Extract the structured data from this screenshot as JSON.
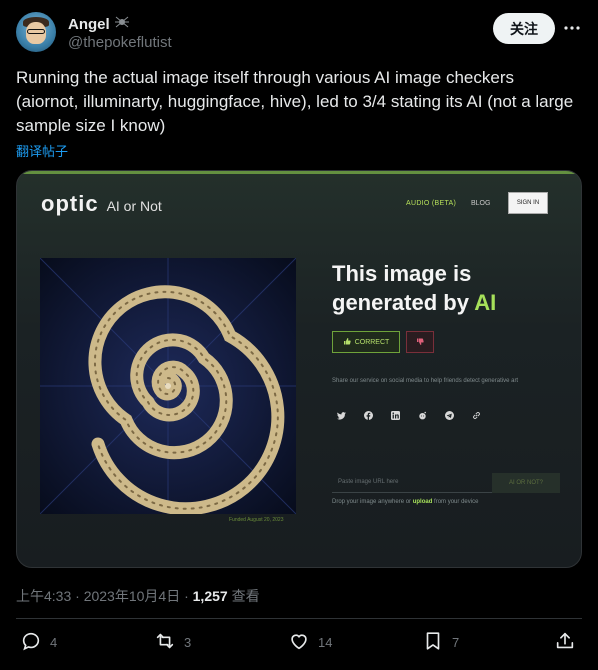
{
  "author": {
    "name": "Angel",
    "badge_icon": "spider-icon",
    "handle": "@thepokeflutist"
  },
  "follow_label": "关注",
  "tweet": {
    "text": "Running the actual image itself through various AI image checkers (aiornot, illuminarty, huggingface, hive), led to 3/4 stating its AI (not a large sample size I know)",
    "translate": "翻译帖子",
    "timestamp": "上午4:33 · 2023年10月4日 · ",
    "views": "1,257",
    "views_label": " 查看"
  },
  "embedded": {
    "logo_word": "optic",
    "logo_sub": "AI or Not",
    "nav_audio": "AUDIO (BETA)",
    "nav_blog": "BLOG",
    "nav_signin": "SIGN IN",
    "headline_line1": "This image is",
    "headline_line2": "generated by ",
    "headline_ai": "AI",
    "correct_label": "CORRECT",
    "share_text": "Share our service on social media to help friends detect generative art",
    "paste_placeholder": "Paste image URL here",
    "ai_button": "AI OR NOT?",
    "drop_prefix": "Drop your image anywhere or ",
    "drop_upload": "upload",
    "drop_suffix": " from your device",
    "credit": "Funded August 20, 2023",
    "accent_color": "#a6e05a"
  },
  "actions": {
    "replies": "4",
    "retweets": "3",
    "likes": "14",
    "bookmarks": "7"
  },
  "colors": {
    "background": "#000000",
    "text": "#e7e9ea",
    "muted": "#71767b",
    "link": "#1d9bf0"
  }
}
